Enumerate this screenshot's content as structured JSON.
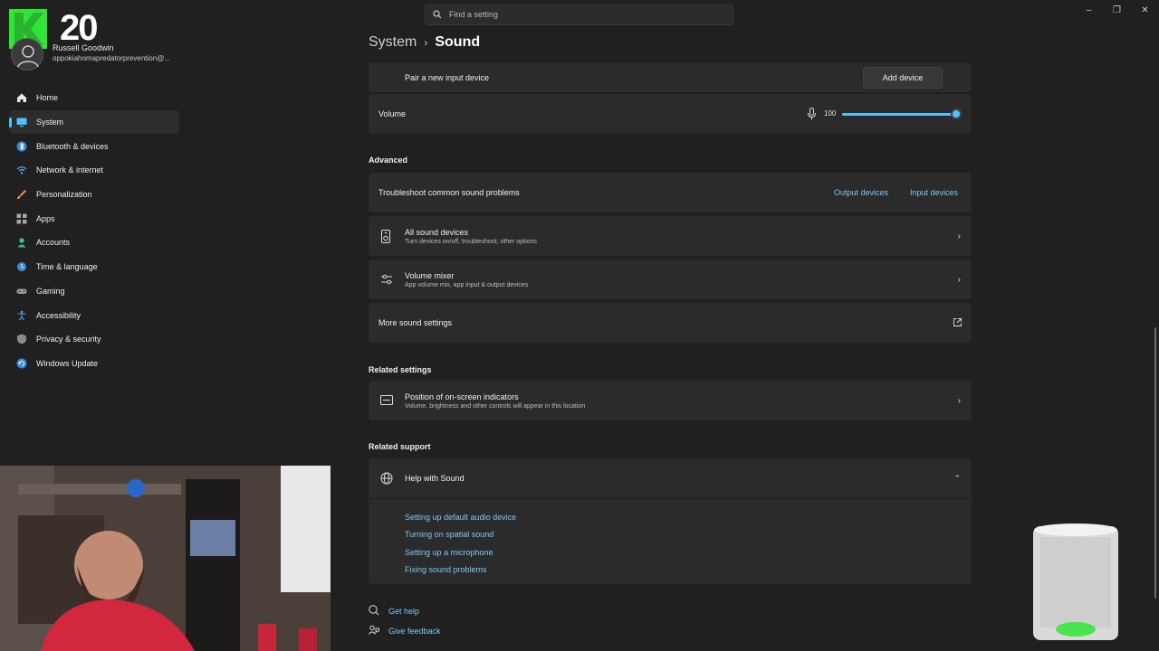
{
  "titlebar": {
    "search_placeholder": "Find a setting",
    "window_controls": [
      "–",
      "❐",
      "✕"
    ]
  },
  "profile": {
    "logo_letter": "K",
    "logo_number": "20",
    "name": "Russell Goodwin",
    "email": "oppokiahomapredatorprevention@..."
  },
  "sidebar": {
    "items": [
      {
        "label": "Home",
        "icon": "home-icon",
        "active": false
      },
      {
        "label": "System",
        "icon": "monitor-icon",
        "active": true
      },
      {
        "label": "Bluetooth & devices",
        "icon": "bluetooth-icon",
        "active": false
      },
      {
        "label": "Network & internet",
        "icon": "wifi-icon",
        "active": false
      },
      {
        "label": "Personalization",
        "icon": "brush-icon",
        "active": false
      },
      {
        "label": "Apps",
        "icon": "apps-icon",
        "active": false
      },
      {
        "label": "Accounts",
        "icon": "person-icon",
        "active": false
      },
      {
        "label": "Time & language",
        "icon": "globe-clock-icon",
        "active": false
      },
      {
        "label": "Gaming",
        "icon": "gamepad-icon",
        "active": false
      },
      {
        "label": "Accessibility",
        "icon": "accessibility-icon",
        "active": false
      },
      {
        "label": "Privacy & security",
        "icon": "shield-icon",
        "active": false
      },
      {
        "label": "Windows Update",
        "icon": "update-icon",
        "active": false
      }
    ]
  },
  "breadcrumb": {
    "parent": "System",
    "separator": "›",
    "current": "Sound"
  },
  "input": {
    "pair_label": "Pair a new input device",
    "add_button": "Add device",
    "volume_label": "Volume",
    "volume_value": "100",
    "volume_fraction": 1.0
  },
  "advanced": {
    "header": "Advanced",
    "troubleshoot_label": "Troubleshoot common sound problems",
    "output_devices": "Output devices",
    "input_devices": "Input devices",
    "all_devices_title": "All sound devices",
    "all_devices_sub": "Turn devices on/off, troubleshoot, other options",
    "mixer_title": "Volume mixer",
    "mixer_sub": "App volume mix, app input & output devices",
    "more_settings": "More sound settings"
  },
  "related_settings": {
    "header": "Related settings",
    "position_title": "Position of on-screen indicators",
    "position_sub": "Volume, brightness and other controls will appear in this location"
  },
  "related_support": {
    "header": "Related support",
    "help_title": "Help with Sound",
    "links": [
      "Setting up default audio device",
      "Turning on spatial sound",
      "Setting up a microphone",
      "Fixing sound problems"
    ]
  },
  "footer": {
    "get_help": "Get help",
    "give_feedback": "Give feedback"
  },
  "colors": {
    "accent": "#4cc2ff",
    "background": "#202020",
    "card": "#2b2b2b",
    "logo_green": "#2ee636"
  }
}
